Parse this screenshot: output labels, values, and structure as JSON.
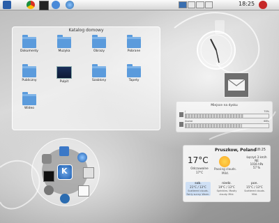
{
  "panel": {
    "time": "18:25",
    "pager_count": 4,
    "pager_active": 0
  },
  "folderview": {
    "title": "Katalog domowy",
    "items": [
      {
        "label": "Dokumenty",
        "type": "folder"
      },
      {
        "label": "Muzyka",
        "type": "folder"
      },
      {
        "label": "Obrazy",
        "type": "folder"
      },
      {
        "label": "Pobrane",
        "type": "folder"
      },
      {
        "label": "Publiczny",
        "type": "folder"
      },
      {
        "label": "Pulpit",
        "type": "file"
      },
      {
        "label": "Szablony",
        "type": "folder"
      },
      {
        "label": "Tapety",
        "type": "folder"
      },
      {
        "label": "Wideo",
        "type": "folder"
      }
    ]
  },
  "disk": {
    "title": "Miejsce na dysku",
    "rows": [
      {
        "label": "/",
        "value": "70%",
        "fill": 0.7
      },
      {
        "label": "/home",
        "value": "68%",
        "fill": 0.68
      }
    ]
  },
  "weather": {
    "location": "Pruszkow, Poland",
    "time": "18:25",
    "temp": "17°C",
    "feels_label": "Odczuwalne",
    "feels_value": "17°C",
    "condition": "Passing clouds. Mild.",
    "wind": "Łęczyń 3 km/h NE\n1016 hPa\n57 %",
    "days": [
      {
        "name": "sob.",
        "temp": "21°C / 13°C",
        "desc": "Scattered clouds. Fairly sunny. Warm."
      },
      {
        "name": "niedz.",
        "temp": "19°C / 13°C",
        "desc": "Sprinkles. Mostly cloudy. Mild."
      },
      {
        "name": "pon.",
        "temp": "15°C / 13°C",
        "desc": "Scattered clouds. Mild."
      }
    ]
  },
  "launcher": {
    "icons": [
      "home-icon",
      "globe-icon",
      "wrench-icon",
      "trash-icon",
      "terminal-icon",
      "notepad-icon",
      "kde-icon",
      "network-icon"
    ]
  }
}
